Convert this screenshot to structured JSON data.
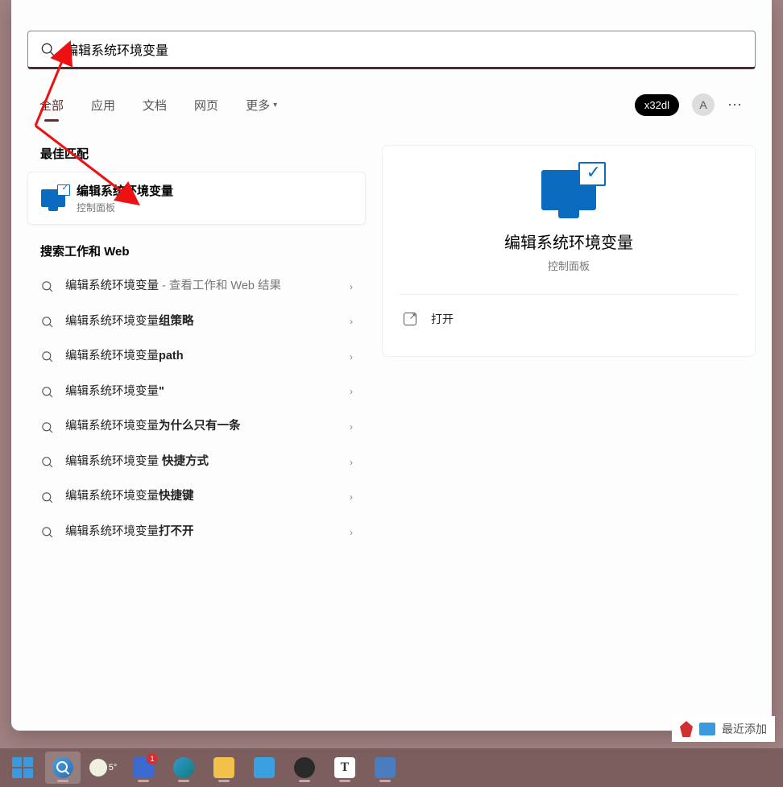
{
  "search": {
    "query": "编辑系统环境变量"
  },
  "tabs": {
    "items": [
      "全部",
      "应用",
      "文档",
      "网页",
      "更多"
    ],
    "active_index": 0
  },
  "header_right": {
    "badge": "x32dl",
    "avatar_initial": "A"
  },
  "sections": {
    "best_match_header": "最佳匹配",
    "web_header": "搜索工作和 Web"
  },
  "best_match": {
    "title": "编辑系统环境变量",
    "subtitle": "控制面板"
  },
  "web_results": [
    {
      "prefix": "编辑系统环境变量",
      "suffix": " - 查看工作和 Web 结果",
      "suffix_light": true
    },
    {
      "prefix": "编辑系统环境变量",
      "suffix": "组策略"
    },
    {
      "prefix": "编辑系统环境变量",
      "suffix": "path"
    },
    {
      "prefix": "编辑系统环境变量",
      "suffix": "\""
    },
    {
      "prefix": "编辑系统环境变量",
      "suffix": "为什么只有一条"
    },
    {
      "prefix": "编辑系统环境变量 ",
      "suffix": "快捷方式"
    },
    {
      "prefix": "编辑系统环境变量",
      "suffix": "快捷键"
    },
    {
      "prefix": "编辑系统环境变量",
      "suffix": "打不开"
    }
  ],
  "detail": {
    "title": "编辑系统环境变量",
    "subtitle": "控制面板",
    "open_label": "打开"
  },
  "taskbar": {
    "weather_temp": "5°",
    "todo_badge": "1"
  },
  "background_snippet": "最近添加"
}
